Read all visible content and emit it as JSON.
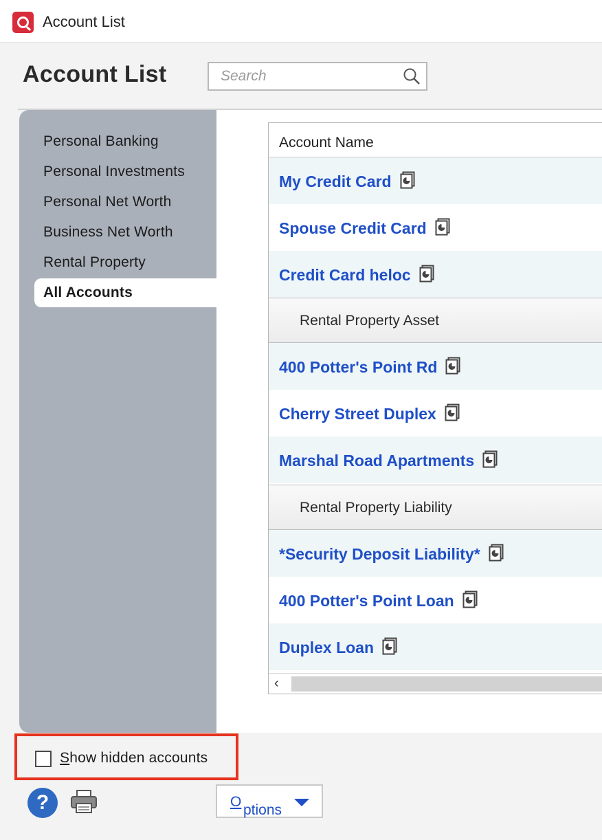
{
  "window": {
    "title": "Account List",
    "logo_icon": "quicken-logo-icon"
  },
  "page": {
    "title": "Account List"
  },
  "search": {
    "placeholder": "Search"
  },
  "sidebar": {
    "items": [
      {
        "label": "Personal Banking",
        "active": false
      },
      {
        "label": "Personal Investments",
        "active": false
      },
      {
        "label": "Personal Net Worth",
        "active": false
      },
      {
        "label": "Business Net Worth",
        "active": false
      },
      {
        "label": "Rental Property",
        "active": false
      },
      {
        "label": "All Accounts",
        "active": true
      }
    ]
  },
  "grid": {
    "column_header": "Account Name",
    "rows": [
      {
        "type": "account",
        "name": "My Credit Card"
      },
      {
        "type": "account",
        "name": "Spouse Credit Card"
      },
      {
        "type": "account",
        "name": "Credit Card heloc"
      },
      {
        "type": "group",
        "name": "Rental Property Asset"
      },
      {
        "type": "account",
        "name": "400 Potter's Point Rd"
      },
      {
        "type": "account",
        "name": "Cherry Street Duplex"
      },
      {
        "type": "account",
        "name": "Marshal Road Apartments"
      },
      {
        "type": "group",
        "name": "Rental Property Liability"
      },
      {
        "type": "account",
        "name": "*Security Deposit Liability*"
      },
      {
        "type": "account",
        "name": "400 Potter's Point Loan"
      },
      {
        "type": "account",
        "name": "Duplex Loan"
      }
    ]
  },
  "footer": {
    "show_hidden_label_prefix": "S",
    "show_hidden_label_rest": "how hidden accounts",
    "show_hidden_checked": false,
    "options_prefix": "O",
    "options_rest": "ptions",
    "help_label": "?"
  },
  "colors": {
    "link": "#1f4fc7",
    "sidebar_bg": "#aab0ba",
    "highlight_border": "#e6331f",
    "alt_row": "#eef6f8"
  }
}
